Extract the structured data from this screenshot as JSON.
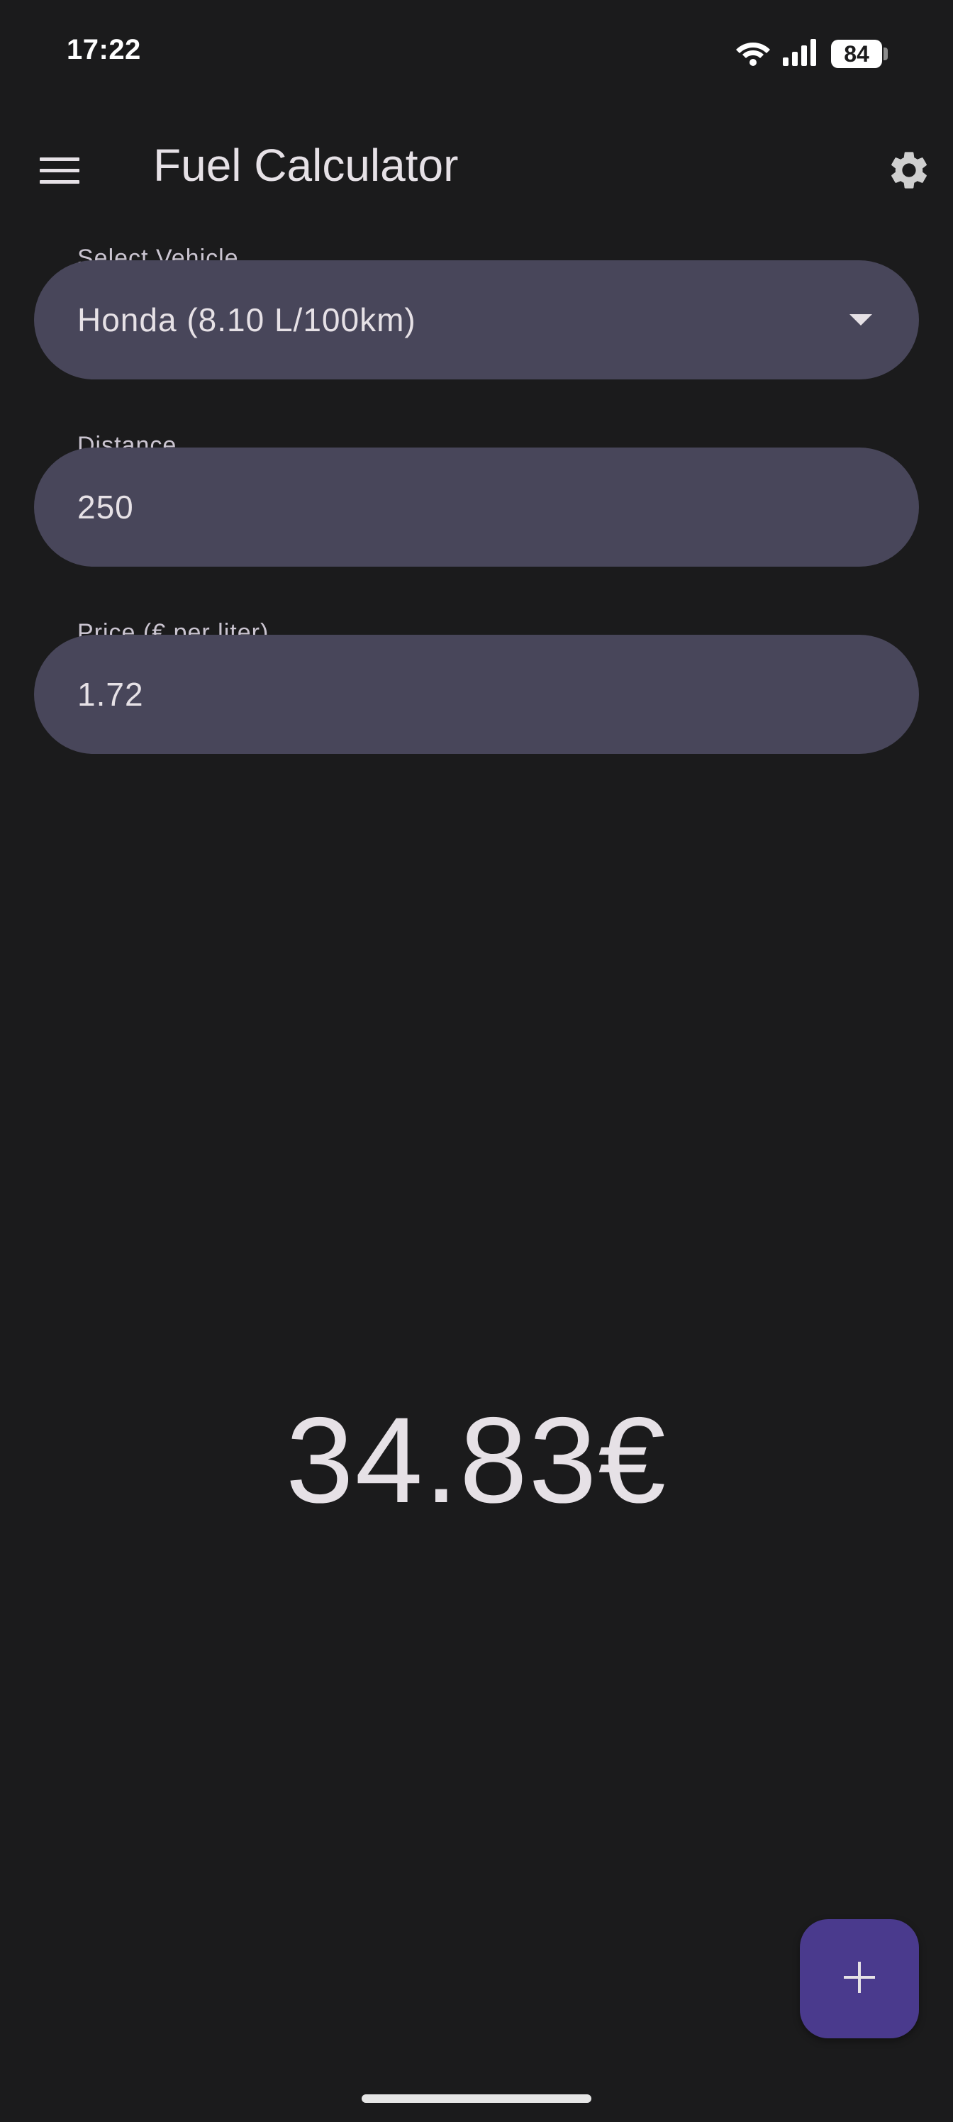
{
  "status_bar": {
    "time": "17:22",
    "battery_level": "84",
    "icons": [
      "wifi-icon",
      "signal-icon",
      "battery-icon"
    ]
  },
  "app_bar": {
    "title": "Fuel Calculator",
    "menu_icon": "menu-icon",
    "settings_icon": "gear-icon"
  },
  "form": {
    "vehicle": {
      "label": "Select Vehicle",
      "value": "Honda (8.10 L/100km)"
    },
    "distance": {
      "label": "Distance",
      "value": "250"
    },
    "price": {
      "label": "Price (€ per liter)",
      "value": "1.72"
    }
  },
  "result": {
    "cost": "34.83€"
  },
  "fab": {
    "icon": "plus-icon"
  },
  "colors": {
    "background": "#1b1b1c",
    "field_background": "#48465a",
    "fab_background": "#4a3a8d",
    "text_primary": "#e6e1e6",
    "text_label": "#cac4d0"
  }
}
